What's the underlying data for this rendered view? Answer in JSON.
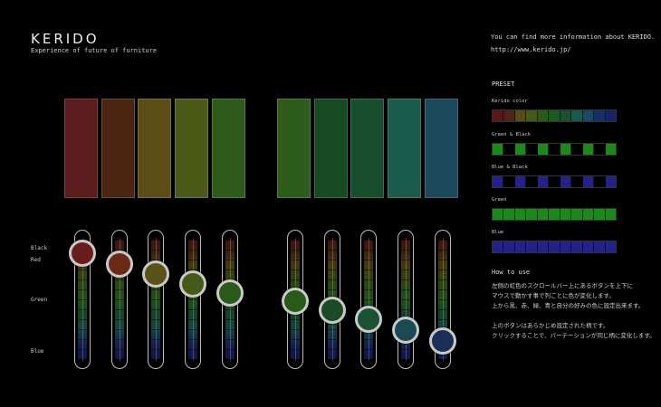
{
  "brand": {
    "title": "KERIDO",
    "subtitle": "Experience of future of furniture"
  },
  "info": {
    "text": "You can find more information about KERIDO.",
    "url": "http://www.kerido.jp/"
  },
  "level_labels": [
    "Black",
    "Red",
    "Green",
    "Blue"
  ],
  "swatches": [
    {
      "color": "#5a1c1c"
    },
    {
      "color": "#4a2612"
    },
    {
      "color": "#5c4e16"
    },
    {
      "color": "#4c5a18"
    },
    {
      "color": "#2e5a1a"
    },
    {
      "color": "#2e5c1a"
    },
    {
      "color": "#174a22"
    },
    {
      "color": "#174e2e"
    },
    {
      "color": "#1c5c4e"
    },
    {
      "color": "#1c4a5c"
    }
  ],
  "sliders": [
    {
      "level": 0.08,
      "knob_color": "#6a1c1c"
    },
    {
      "level": 0.18,
      "knob_color": "#6a2a16"
    },
    {
      "level": 0.28,
      "knob_color": "#5a5216"
    },
    {
      "level": 0.37,
      "knob_color": "#445a16"
    },
    {
      "level": 0.46,
      "knob_color": "#2a5a1a"
    },
    {
      "level": 0.54,
      "knob_color": "#2a5a1a"
    },
    {
      "level": 0.63,
      "knob_color": "#1a4a26"
    },
    {
      "level": 0.71,
      "knob_color": "#1a5234"
    },
    {
      "level": 0.82,
      "knob_color": "#1a4a52"
    },
    {
      "level": 0.92,
      "knob_color": "#1a2e5a"
    }
  ],
  "preset": {
    "heading": "PRESET",
    "items": [
      {
        "label": "Kerido color",
        "cells": [
          "#5a1818",
          "#4a2614",
          "#5a4a16",
          "#465a16",
          "#2a5a18",
          "#1a5a24",
          "#1a5230",
          "#1a5a4a",
          "#1a4a5c",
          "#1a2e66",
          "#1c1e70"
        ]
      },
      {
        "label": "Green & Black",
        "cells": [
          "#1a8a1a",
          "#000000",
          "#1a8a1a",
          "#000000",
          "#1a8a1a",
          "#000000",
          "#1a8a1a",
          "#000000",
          "#1a8a1a",
          "#000000",
          "#1a8a1a"
        ]
      },
      {
        "label": "Blue & Black",
        "cells": [
          "#22228a",
          "#000000",
          "#22228a",
          "#000000",
          "#22228a",
          "#000000",
          "#22228a",
          "#000000",
          "#22228a",
          "#000000",
          "#22228a"
        ]
      },
      {
        "label": "Green",
        "cells": [
          "#1a8a1a",
          "#1a8a1a",
          "#1a8a1a",
          "#1a8a1a",
          "#1a8a1a",
          "#1a8a1a",
          "#1a8a1a",
          "#1a8a1a",
          "#1a8a1a",
          "#1a8a1a",
          "#1a8a1a"
        ]
      },
      {
        "label": "Blue",
        "cells": [
          "#22228a",
          "#22228a",
          "#22228a",
          "#22228a",
          "#22228a",
          "#22228a",
          "#22228a",
          "#22228a",
          "#22228a",
          "#22228a",
          "#22228a"
        ]
      }
    ]
  },
  "howto": {
    "heading": "How to use",
    "lines": [
      "左側の虹色のスクロールバー上にあるボタンを上下に",
      "マウスで動かす事で列ごとに色が変化します。",
      "上から黒、赤、緑、青と自分の好みの色に設定出来ます。",
      "",
      "上のボタンはあらかじめ設定された柄です。",
      "クリックすることで、パーテーションが同じ柄に変化します。"
    ]
  }
}
